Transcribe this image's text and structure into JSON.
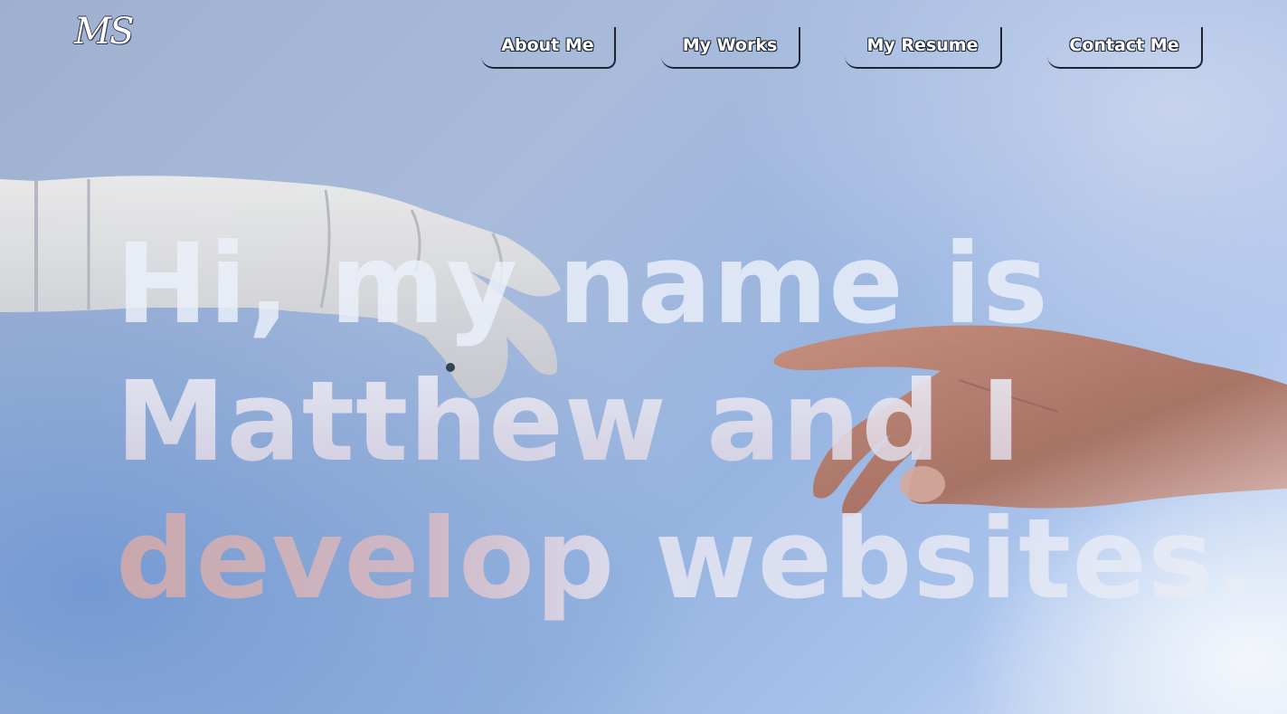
{
  "site": {
    "logo_text": "MS"
  },
  "nav": {
    "items": [
      {
        "label": "About Me"
      },
      {
        "label": "My Works"
      },
      {
        "label": "My Resume"
      },
      {
        "label": "Contact Me"
      }
    ]
  },
  "hero": {
    "lines": [
      "Hi, my name is",
      "Matthew and I",
      "develop websites."
    ]
  },
  "background": {
    "image_subject": "robot-hand-and-human-hand-reaching",
    "colors": {
      "base_blue": "#a9bbdb",
      "highlight": "#f5f8fc",
      "robot_hand": "#e4e2df",
      "human_skin": "#b77e6c",
      "nav_border": "#1f2435"
    }
  }
}
